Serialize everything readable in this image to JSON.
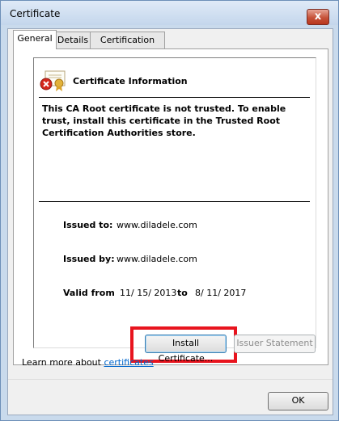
{
  "window": {
    "title": "Certificate",
    "close_glyph": "x"
  },
  "tabs": [
    {
      "label": "General",
      "active": true
    },
    {
      "label": "Details",
      "active": false
    },
    {
      "label": "Certification Path",
      "active": false
    }
  ],
  "info": {
    "heading": "Certificate Information",
    "icon": "certificate-error-icon",
    "warning": "This CA Root certificate is not trusted. To enable trust, install this certificate in the Trusted Root Certification Authorities store."
  },
  "details": {
    "issued_to_label": "Issued to:",
    "issued_to": "www.diladele.com",
    "issued_by_label": "Issued by:",
    "issued_by": "www.diladele.com",
    "valid_from_label": "Valid from",
    "valid_from": "11/ 15/ 2013",
    "to_label": "to",
    "valid_to": "8/ 11/ 2017"
  },
  "buttons": {
    "install": "Install Certificate...",
    "issuer": "Issuer Statement",
    "ok": "OK"
  },
  "learn": {
    "prefix": "Learn more about ",
    "link": "certificates"
  },
  "colors": {
    "highlight": "#e8141e",
    "link": "#0066cc"
  }
}
